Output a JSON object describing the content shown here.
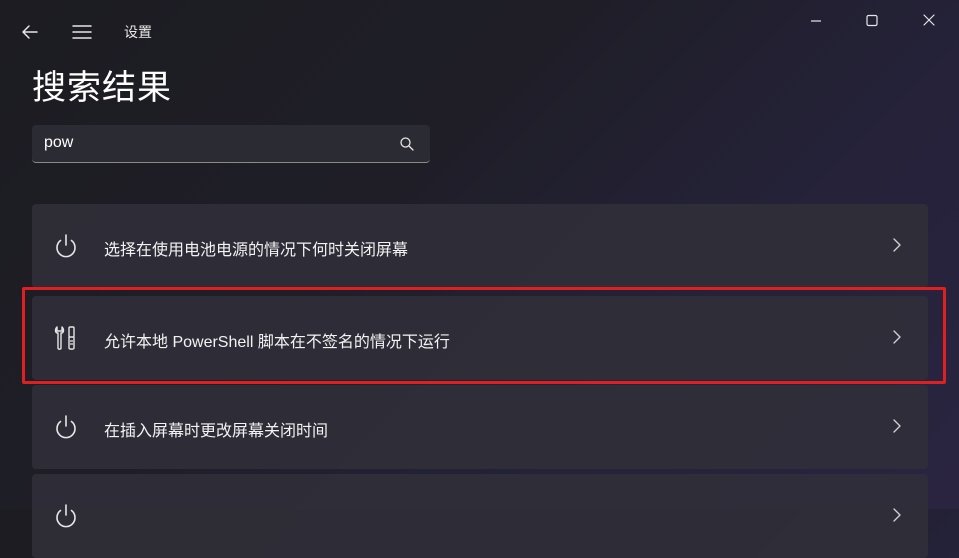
{
  "window": {
    "app_title": "设置",
    "controls": [
      "minimize-icon",
      "maximize-icon",
      "close-icon"
    ]
  },
  "nav": {
    "back_icon": "back-arrow-icon",
    "menu_icon": "hamburger-menu-icon"
  },
  "page": {
    "title": "搜索结果"
  },
  "search": {
    "value": "pow",
    "icon": "search-icon"
  },
  "results": [
    {
      "label": "选择在使用电池电源的情况下何时关闭屏幕",
      "icon": "power-icon"
    },
    {
      "label": "允许本地 PowerShell 脚本在不签名的情况下运行",
      "icon": "developer-tools-icon",
      "highlighted": true
    },
    {
      "label": "在插入屏幕时更改屏幕关闭时间",
      "icon": "power-icon"
    },
    {
      "label": "",
      "icon": "power-icon"
    }
  ],
  "colors": {
    "highlight_border": "#e02020",
    "card_background": "#302f38"
  }
}
